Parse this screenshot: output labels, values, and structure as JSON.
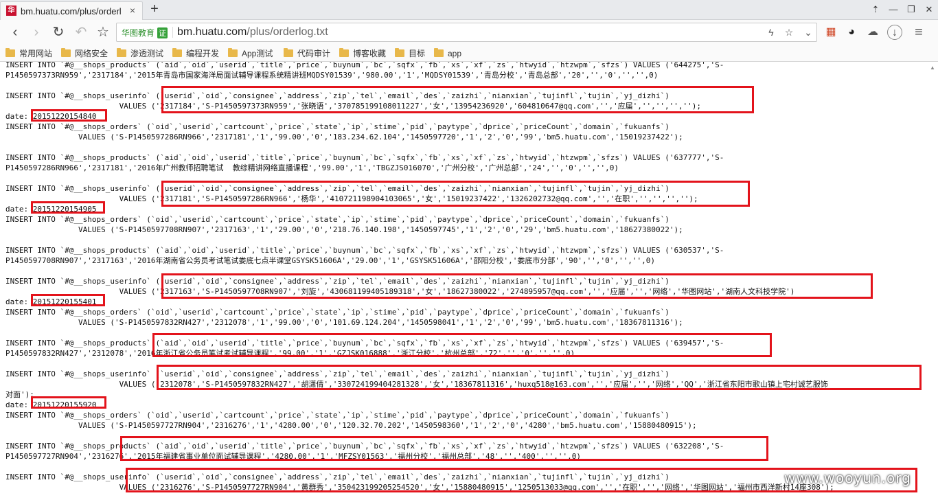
{
  "browser": {
    "tab": {
      "title": "bm.huatu.com/plus/orderl",
      "close": "×"
    },
    "new_tab": "+",
    "window_controls": [
      "⇡",
      "—",
      "❐",
      "✕"
    ],
    "nav": {
      "back": "‹",
      "forward": "›",
      "reload": "↻",
      "undo": "↶",
      "bookmark_star": "☆"
    },
    "site_badge": {
      "name": "华图教育",
      "mark": "证"
    },
    "url": {
      "host": "bm.huatu.com",
      "path": "/plus/orderlog.txt"
    },
    "address_icons": {
      "lightning": "ϟ",
      "star": "☆",
      "dropdown": "⌄"
    },
    "toolbar_icons": {
      "apps": "▦",
      "qq": "◕",
      "cloud": "☁",
      "download": "↓",
      "menu": "≡"
    }
  },
  "bookmarks": [
    {
      "label": "常用网站"
    },
    {
      "label": "网络安全"
    },
    {
      "label": "渗透测试"
    },
    {
      "label": "编程开发"
    },
    {
      "label": "App测试"
    },
    {
      "label": "代码审计"
    },
    {
      "label": "博客收藏"
    },
    {
      "label": "目标"
    },
    {
      "label": "app"
    }
  ],
  "document": {
    "lines": [
      "INSERT INTO `#@__shops_products` (`aid`,`oid`,`userid`,`title`,`price`,`buynum`,`bc`,`sqfx`,`fb`,`xs`,`xf`,`zs`,`htwyid`,`htzwpm`,`sfzs`) VALUES ('644275','S-",
      "P1450597373RN959','2317184','2015年青岛市国家海洋局面试辅导课程系统精讲班MQDSY01539','980.00','1','MQDSY01539','青岛分校','青岛总部','20','','0','','',0)",
      "",
      "INSERT INTO `#@__shops_userinfo` (`userid`,`oid`,`consignee`,`address`,`zip`,`tel`,`email`,`des`,`zaizhi`,`nianxian`,`tujinfl`,`tujin`,`yj_dizhi`)",
      "                         VALUES ('2317184','S-P1450597373RN959','张晓语','370785199108011227','女','13954236920','604810647@qq.com','','应届','','','','');",
      "date: 20151220154840",
      "INSERT INTO `#@__shops_orders` (`oid`,`userid`,`cartcount`,`price`,`state`,`ip`,`stime`,`pid`,`paytype`,`dprice`,`priceCount`,`domain`,`fukuanfs`)",
      "                VALUES ('S-P1450597286RN966','2317181','1','99.00','0','183.234.62.104','1450597720','1','2','0','99','bm5.huatu.com','15019237422');",
      "",
      "INSERT INTO `#@__shops_products` (`aid`,`oid`,`userid`,`title`,`price`,`buynum`,`bc`,`sqfx`,`fb`,`xs`,`xf`,`zs`,`htwyid`,`htzwpm`,`sfzs`) VALUES ('637777','S-",
      "P1450597286RN966','2317181','2016年广州教师招聘笔试  教综精讲网络直播课程','99.00','1','TBGZJS016070','广州分校','广州总部','24','','0','','',0)",
      "",
      "INSERT INTO `#@__shops_userinfo` (`userid`,`oid`,`consignee`,`address`,`zip`,`tel`,`email`,`des`,`zaizhi`,`nianxian`,`tujinfl`,`tujin`,`yj_dizhi`)",
      "                         VALUES ('2317181','S-P1450597286RN966','杨华','410721198904103065','女','15019237422','1326202732@qq.com','','在职','','','','');",
      "date: 20151220154905",
      "INSERT INTO `#@__shops_orders` (`oid`,`userid`,`cartcount`,`price`,`state`,`ip`,`stime`,`pid`,`paytype`,`dprice`,`priceCount`,`domain`,`fukuanfs`)",
      "                VALUES ('S-P1450597708RN907','2317163','1','29.00','0','218.76.140.198','1450597745','1','2','0','29','bm5.huatu.com','18627380022');",
      "",
      "INSERT INTO `#@__shops_products` (`aid`,`oid`,`userid`,`title`,`price`,`buynum`,`bc`,`sqfx`,`fb`,`xs`,`xf`,`zs`,`htwyid`,`htzwpm`,`sfzs`) VALUES ('630537','S-",
      "P1450597708RN907','2317163','2016年湖南省公务员考试笔试娄底七点半课堂GSYSK51606A','29.00','1','GSYSK51606A','邵阳分校','娄底市分部','90','','0','','',0)",
      "",
      "INSERT INTO `#@__shops_userinfo` (`userid`,`oid`,`consignee`,`address`,`zip`,`tel`,`email`,`des`,`zaizhi`,`nianxian`,`tujinfl`,`tujin`,`yj_dizhi`)",
      "                         VALUES ('2317163','S-P1450597708RN907','刘旋','430681199405189318','女','18627380022','274895957@qq.com','','应届','','网络','华图网站','湖南人文科技学院')",
      "date: 20151220155401",
      "INSERT INTO `#@__shops_orders` (`oid`,`userid`,`cartcount`,`price`,`state`,`ip`,`stime`,`pid`,`paytype`,`dprice`,`priceCount`,`domain`,`fukuanfs`)",
      "                VALUES ('S-P1450597832RN427','2312078','1','99.00','0','101.69.124.204','1450598041','1','2','0','99','bm5.huatu.com','18367811316');",
      "",
      "INSERT INTO `#@__shops_products` (`aid`,`oid`,`userid`,`title`,`price`,`buynum`,`bc`,`sqfx`,`fb`,`xs`,`xf`,`zs`,`htwyid`,`htzwpm`,`sfzs`) VALUES ('639457','S-",
      "P1450597832RN427','2312078','2016年浙江省公务员笔试考试辅导课程','99.00','1','GZJSK016888','浙江分校','杭州总部','72','','0','','',0)",
      "",
      "INSERT INTO `#@__shops_userinfo` (`userid`,`oid`,`consignee`,`address`,`zip`,`tel`,`email`,`des`,`zaizhi`,`nianxian`,`tujinfl`,`tujin`,`yj_dizhi`)",
      "                         VALUES ('2312078','S-P1450597832RN427','胡潇倩','330724199404281328','女','18367811316','huxq518@163.com','','应届','','网络','QQ','浙江省东阳市歌山镇上宅村诚艺服饰",
      "对面');",
      "date: 20151220155920",
      "INSERT INTO `#@__shops_orders` (`oid`,`userid`,`cartcount`,`price`,`state`,`ip`,`stime`,`pid`,`paytype`,`dprice`,`priceCount`,`domain`,`fukuanfs`)",
      "                VALUES ('S-P1450597727RN904','2316276','1','4280.00','0','120.32.70.202','1450598360','1','2','0','4280','bm5.huatu.com','15880480915');",
      "",
      "INSERT INTO `#@__shops_products` (`aid`,`oid`,`userid`,`title`,`price`,`buynum`,`bc`,`sqfx`,`fb`,`xs`,`xf`,`zs`,`htwyid`,`htzwpm`,`sfzs`) VALUES ('632208','S-",
      "P1450597727RN904','2316276','2015年福建省事业单位面试辅导课程','4280.00','1','MFZSY01563','福州分校','福州总部','48','','400','','',0)",
      "",
      "INSERT INTO `#@__shops_userinfo` (`userid`,`oid`,`consignee`,`address`,`zip`,`tel`,`email`,`des`,`zaizhi`,`nianxian`,`tujinfl`,`tujin`,`yj_dizhi`)",
      "                         VALUES ('2316276','S-P1450597727RN904','黄群秀','350423199205254520','女','15880480915','1250513033@qq.com','','在职','','网络','华图网站','福州市西洋新村14座308');"
    ],
    "colors": {
      "highlight": "#e3131b"
    }
  },
  "watermark": {
    "text": "www.wooyun.org"
  }
}
